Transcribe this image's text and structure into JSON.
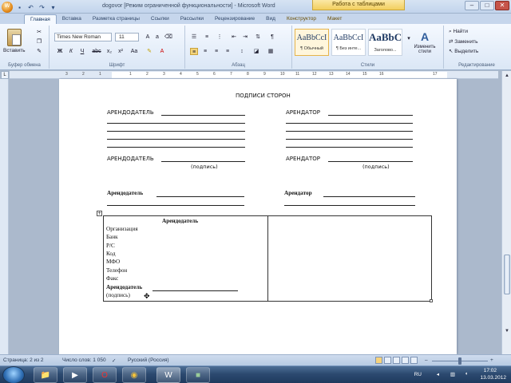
{
  "window": {
    "title": "dogovor [Режим ограниченной функциональности] - Microsoft Word",
    "context_tab_title": "Работа с таблицами",
    "controls": [
      "–",
      "□",
      "✕"
    ]
  },
  "quick_access": {
    "icons": [
      "office-button-icon",
      "save-icon",
      "undo-icon",
      "redo-icon",
      "customize-icon"
    ]
  },
  "ribbon_tabs": [
    "Главная",
    "Вставка",
    "Разметка страницы",
    "Ссылки",
    "Рассылки",
    "Рецензирование",
    "Вид",
    "Конструктор",
    "Макет"
  ],
  "clipboard": {
    "paste_label": "Вставить",
    "group_label": "Буфер обмена"
  },
  "font": {
    "name": "Times New Roman",
    "size": "11",
    "group_label": "Шрифт",
    "format_buttons": [
      "Ж",
      "К",
      "Ч",
      "abc",
      "x₂",
      "x²",
      "Aa"
    ]
  },
  "paragraph": {
    "group_label": "Абзац"
  },
  "styles": {
    "group_label": "Стили",
    "items": [
      {
        "sample": "AaBbCcI",
        "name": "¶ Обычный"
      },
      {
        "sample": "AaBbCcI",
        "name": "¶ Без инте..."
      },
      {
        "sample": "AaBbC",
        "name": "Заголово..."
      }
    ],
    "change_styles_label": "Изменить стили"
  },
  "editing": {
    "group_label": "Редактирование",
    "items": [
      "Найти",
      "Заменить",
      "Выделить"
    ]
  },
  "ruler": {
    "numbers": [
      "3",
      "2",
      "1",
      "1",
      "2",
      "3",
      "4",
      "5",
      "6",
      "7",
      "8",
      "9",
      "10",
      "11",
      "12",
      "13",
      "14",
      "15",
      "16",
      "17"
    ]
  },
  "document": {
    "heading": "ПОДПИСИ СТОРОН",
    "left_label_1": "АРЕНДОДАТЕЛЬ",
    "right_label_1": "АРЕНДАТОР",
    "left_label_2": "АРЕНДОДАТЕЛЬ",
    "right_label_2": "АРЕНДАТОР",
    "sign_note_left": "(подпись)",
    "sign_note_right": "(подпись)",
    "left_label_3": "Арендодатель",
    "right_label_3": "Арендатор",
    "table": {
      "header": "Арендодатель",
      "rows": [
        "Организация",
        "Банк",
        "Р/С",
        "Код",
        "МФО",
        "Телефон",
        "Факс"
      ],
      "sign_label": "Арендодатель",
      "sign_note": "(подпись)"
    }
  },
  "status_bar": {
    "page": "Страница: 2 из 2",
    "words": "Число слов: 1 050",
    "language": "Русский (Россия)"
  },
  "taskbar": {
    "apps": [
      {
        "icon": "folder-icon",
        "glyph": "📁"
      },
      {
        "icon": "media-player-icon",
        "glyph": "▶"
      },
      {
        "icon": "opera-icon",
        "glyph": "O"
      },
      {
        "icon": "chrome-icon",
        "glyph": "◉"
      },
      {
        "icon": "word-icon",
        "glyph": "W"
      },
      {
        "icon": "recorder-icon",
        "glyph": "■"
      }
    ],
    "lang": "RU",
    "time": "17:02",
    "date": "13.03.2012"
  }
}
